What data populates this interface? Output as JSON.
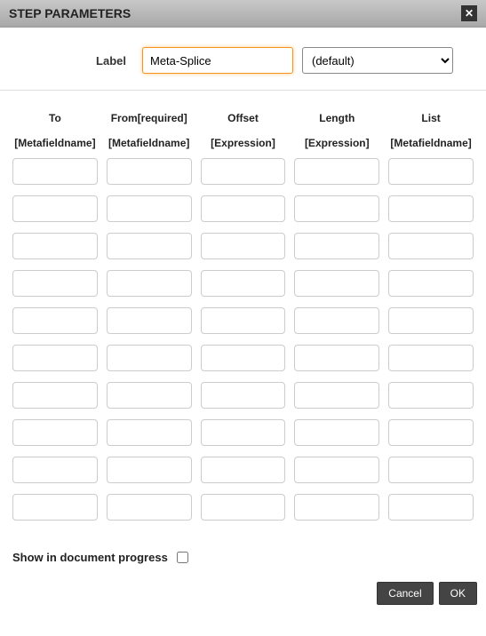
{
  "titlebar": {
    "title": "STEP PARAMETERS",
    "close_icon": "✕"
  },
  "labelRow": {
    "label_text": "Label",
    "label_value": "Meta-Splice",
    "select_value": "(default)"
  },
  "grid": {
    "headers": [
      "To",
      "From[required]",
      "Offset",
      "Length",
      "List"
    ],
    "subheaders": [
      "[Metafieldname]",
      "[Metafieldname]",
      "[Expression]",
      "[Expression]",
      "[Metafieldname]"
    ],
    "rows": [
      [
        "",
        "",
        "",
        "",
        ""
      ],
      [
        "",
        "",
        "",
        "",
        ""
      ],
      [
        "",
        "",
        "",
        "",
        ""
      ],
      [
        "",
        "",
        "",
        "",
        ""
      ],
      [
        "",
        "",
        "",
        "",
        ""
      ],
      [
        "",
        "",
        "",
        "",
        ""
      ],
      [
        "",
        "",
        "",
        "",
        ""
      ],
      [
        "",
        "",
        "",
        "",
        ""
      ],
      [
        "",
        "",
        "",
        "",
        ""
      ],
      [
        "",
        "",
        "",
        "",
        ""
      ]
    ]
  },
  "checkbox": {
    "label": "Show in document progress",
    "checked": false
  },
  "footer": {
    "cancel": "Cancel",
    "ok": "OK"
  }
}
